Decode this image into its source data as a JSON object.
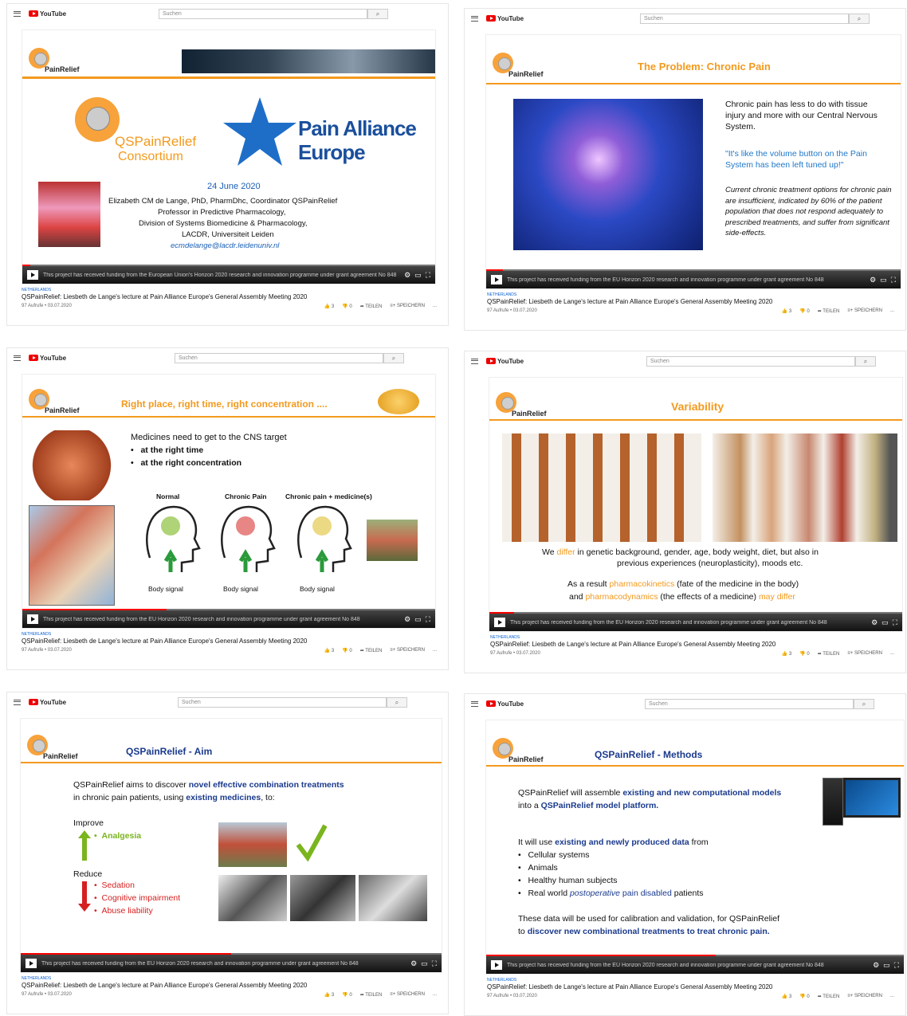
{
  "common": {
    "youtube_label": "YouTube",
    "search_placeholder": "Suchen",
    "search_icon": "⌕",
    "location_tag": "NETHERLANDS",
    "video_title": "QSPainRelief: Liesbeth de Lange's lecture at Pain Alliance Europe's General Assembly Meeting 2020",
    "views_date": "97 Aufrufe • 03.07.2020",
    "like_count": "3",
    "dislike_count": "0",
    "share_label": "TEILEN",
    "save_label": "SPEICHERN",
    "more_label": "...",
    "ticker_eu": "This project has received funding from the European Union's Horizon 2020 research and innovation programme under grant agreement No 848",
    "ticker_eu_short": "This project has received funding from the EU Horizon 2020 research and innovation programme under grant agreement No 848",
    "logo_text": "PainRelief"
  },
  "slide1": {
    "consortium_a": "QSPainRelief",
    "consortium_b": "Consortium",
    "alliance_a": "Pain Alliance",
    "alliance_b": "Europe",
    "date": "24 June 2020",
    "line1": "Elizabeth CM de Lange, PhD, PharmDhc, Coordinator QSPainRelief",
    "line2": "Professor in Predictive Pharmacology,",
    "line3": "Division of Systems Biomedicine & Pharmacology,",
    "line4": "LACDR, Universiteit Leiden",
    "email": "ecmdelange@lacdr.leidenuniv.nl",
    "progress": 0.02
  },
  "slide2": {
    "title": "The Problem: Chronic Pain",
    "p1": "Chronic pain has less to do with tissue injury and more with our Central Nervous System.",
    "p2": "\"It's like the volume button on the Pain System has been left tuned up!\"",
    "p3": "Current chronic treatment options for chronic pain are insufficient, indicated by 60% of the patient population that does not respond adequately to prescribed treatments, and suffer from significant side-effects.",
    "progress": 0.04
  },
  "slide3": {
    "title": "Right place, right time, right concentration ....",
    "intro": "Medicines need to get to the CNS target",
    "b1": "at the right time",
    "b2": "at the right concentration",
    "h1": "Normal",
    "h2": "Chronic Pain",
    "h3": "Chronic pain + medicine(s)",
    "signal": "Body signal",
    "progress": 0.35
  },
  "slide4": {
    "title": "Variability",
    "l1_pre": "We ",
    "l1_hl": "differ",
    "l1_post": " in genetic background, gender, age, body weight, diet, but also in",
    "l2": "previous experiences (neuroplasticity), moods etc.",
    "l3_pre": "As a result ",
    "l3_hl": "pharmacokinetics",
    "l3_post": " (fate of the medicine in the body)",
    "l4_pre": "and ",
    "l4_hl": "pharmacodynamics",
    "l4_mid": " (the effects of a medicine) ",
    "l4_hl2": "may differ",
    "progress": 0.06
  },
  "slide5": {
    "title": "QSPainRelief - Aim",
    "l1_pre": "QSPainRelief aims to discover ",
    "l1_hl": "novel effective combination treatments",
    "l2_pre": "in chronic pain patients, using ",
    "l2_hl": "existing medicines",
    "l2_post": ", to:",
    "improve": "Improve",
    "analgesia": "Analgesia",
    "reduce": "Reduce",
    "r1": "Sedation",
    "r2": "Cognitive impairment",
    "r3": "Abuse liability",
    "progress": 0.5
  },
  "slide6": {
    "title": "QSPainRelief - Methods",
    "l1_pre": "QSPainRelief will assemble ",
    "l1_hl": "existing and new computational models",
    "l2_pre": "into a ",
    "l2_hl": "QSPainRelief model platform.",
    "l3_pre": "It will use ",
    "l3_hl": "existing and newly produced data",
    "l3_post": " from",
    "i1": "Cellular systems",
    "i2": "Animals",
    "i3": "Healthy human subjects",
    "i4_pre": "Real world ",
    "i4_hl": "postoperative",
    "i4_mid": " pain ",
    "i4_hl2": "disabled",
    "i4_post": " patients",
    "l5": "These data will be used for calibration and validation, for QSPainRelief",
    "l6_pre": "to ",
    "l6_hl": "discover new combinational treatments to treat chronic pain.",
    "progress": 0.55
  }
}
